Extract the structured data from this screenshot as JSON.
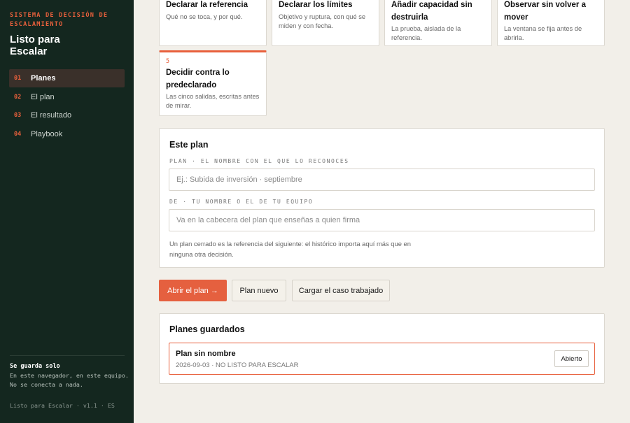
{
  "app": {
    "tag": "SISTEMA DE DECISIÓN DE ESCALAMIENTO",
    "title": "Listo para Escalar"
  },
  "nav": [
    {
      "num": "01",
      "label": "Planes",
      "active": true
    },
    {
      "num": "02",
      "label": "El plan",
      "active": false
    },
    {
      "num": "03",
      "label": "El resultado",
      "active": false
    },
    {
      "num": "04",
      "label": "Playbook",
      "active": false
    }
  ],
  "footer": {
    "save_title": "Se guarda solo",
    "save_desc": "En este navegador, en este equipo. No se conecta a nada.",
    "version": "Listo para Escalar · v1.1 · ES"
  },
  "steps": [
    {
      "title": "Declarar la referencia",
      "desc": "Qué no se toca, y por qué."
    },
    {
      "title": "Declarar los límites",
      "desc": "Objetivo y ruptura, con qué se miden y con fecha."
    },
    {
      "title": "Añadir capacidad sin destruirla",
      "desc": "La prueba, aislada de la referencia."
    },
    {
      "title": "Observar sin volver a mover",
      "desc": "La ventana se fija antes de abrirla."
    },
    {
      "num": "5",
      "title": "Decidir contra lo predeclarado",
      "desc": "Las cinco salidas, escritas antes de mirar."
    }
  ],
  "plan_form": {
    "title": "Este plan",
    "plan_label": "PLAN · EL NOMBRE CON EL QUE LO RECONOCES",
    "plan_placeholder": "Ej.: Subida de inversión · septiembre",
    "plan_value": "",
    "owner_label": "DE · TU NOMBRE O EL DE TU EQUIPO",
    "owner_placeholder": "Va en la cabecera del plan que enseñas a quien firma",
    "owner_value": "",
    "hint": "Un plan cerrado es la referencia del siguiente: el histórico importa aquí más que en ninguna otra decisión."
  },
  "actions": {
    "open": "Abrir el plan →",
    "new": "Plan nuevo",
    "load_example": "Cargar el caso trabajado"
  },
  "saved": {
    "title": "Planes guardados",
    "items": [
      {
        "name": "Plan sin nombre",
        "meta": "2026-09-03 · NO LISTO PARA ESCALAR",
        "status": "Abierto"
      }
    ]
  },
  "colors": {
    "accent": "#e5603f",
    "sidebar_bg": "#14271f",
    "page_bg": "#f2efe9"
  }
}
